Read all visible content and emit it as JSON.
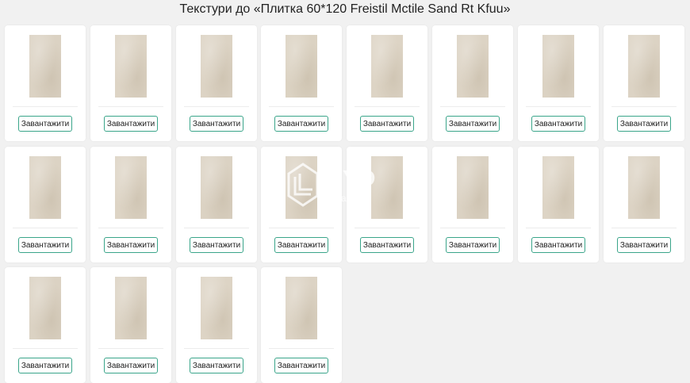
{
  "page": {
    "title": "Текстури до «Плитка 60*120 Freistil Mctile Sand Rt Kfuu»"
  },
  "download_label": "Завантажити",
  "cards": [
    {
      "tile_color": "#dbd2c3"
    },
    {
      "tile_color": "#ddd4c5"
    },
    {
      "tile_color": "#dcd3c4"
    },
    {
      "tile_color": "#dbd2c2"
    },
    {
      "tile_color": "#ddd4c5"
    },
    {
      "tile_color": "#dcd3c4"
    },
    {
      "tile_color": "#dbd2c3"
    },
    {
      "tile_color": "#dcd3c4"
    },
    {
      "tile_color": "#dcd3c4"
    },
    {
      "tile_color": "#ddd4c5"
    },
    {
      "tile_color": "#dbd2c3"
    },
    {
      "tile_color": "#dcd3c4"
    },
    {
      "tile_color": "#dcd3c4"
    },
    {
      "tile_color": "#dbd2c3"
    },
    {
      "tile_color": "#ddd4c5"
    },
    {
      "tile_color": "#dcd3c4"
    },
    {
      "tile_color": "#dbd2c3"
    },
    {
      "tile_color": "#dcd3c4"
    },
    {
      "tile_color": "#ddd4c5"
    },
    {
      "tile_color": "#dcd3c4"
    }
  ],
  "watermark": {
    "brand": "YO",
    "subtitle": "а Пли"
  },
  "colors": {
    "accent": "#3aa58a",
    "background": "#f1f1f1",
    "card": "#ffffff",
    "tile": "#dcd3c4"
  },
  "icons": {
    "watermark_logo": "watermark-logo-icon"
  }
}
